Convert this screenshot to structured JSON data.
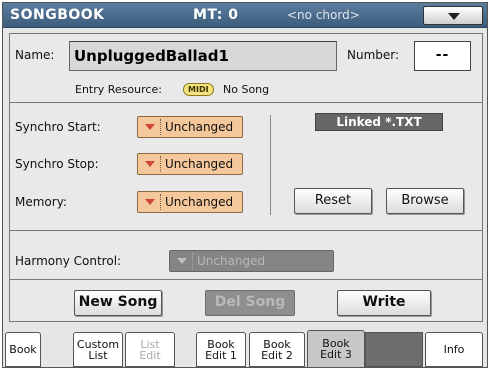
{
  "header": {
    "title": "SONGBOOK",
    "mt": "MT: 0",
    "chord": "<no chord>"
  },
  "name_section": {
    "name_label": "Name:",
    "name_value": "UnpluggedBallad1",
    "number_label": "Number:",
    "number_value": "--",
    "entry_resource_label": "Entry Resource:",
    "midi_badge": "MIDI",
    "entry_resource_value": "No Song"
  },
  "settings": {
    "synchro_start": {
      "label": "Synchro Start:",
      "value": "Unchanged"
    },
    "synchro_stop": {
      "label": "Synchro Stop:",
      "value": "Unchanged"
    },
    "memory": {
      "label": "Memory:",
      "value": "Unchanged"
    },
    "linked_txt": "Linked *.TXT",
    "reset_label": "Reset",
    "browse_label": "Browse"
  },
  "harmony": {
    "label": "Harmony Control:",
    "value": "Unchanged"
  },
  "actions": {
    "new_song": "New Song",
    "del_song": "Del Song",
    "write": "Write"
  },
  "tabs": [
    {
      "line1": "Book",
      "line2": ""
    },
    {
      "line1": "Custom",
      "line2": "List"
    },
    {
      "line1": "List",
      "line2": "Edit"
    },
    {
      "line1": "Book",
      "line2": "Edit 1"
    },
    {
      "line1": "Book",
      "line2": "Edit 2"
    },
    {
      "line1": "Book",
      "line2": "Edit 3"
    },
    {
      "line1": "Info",
      "line2": ""
    }
  ]
}
